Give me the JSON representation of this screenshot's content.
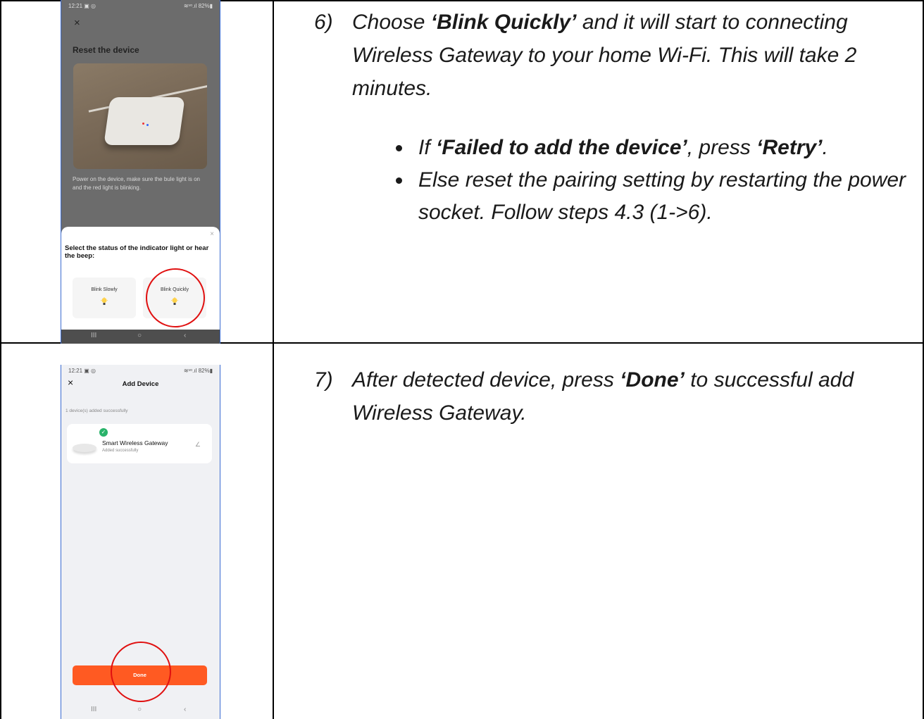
{
  "step6": {
    "number": "6)",
    "parts": [
      "Choose ",
      "‘Blink Quickly’",
      " and it will start to connecting Wireless Gateway to your home Wi-Fi. This will take 2 minutes."
    ],
    "bullet1": [
      "If ",
      "‘Failed to add the device’",
      ", press ",
      "‘Retry’",
      "."
    ],
    "bullet2": "Else reset the pairing setting by restarting the power socket. Follow steps 4.3 (1->6)."
  },
  "step7": {
    "number": "7)",
    "parts": [
      "After detected device, press ",
      "‘Done’",
      " to successful add Wireless Gateway."
    ]
  },
  "screen1": {
    "status_time": "12:21 ▣ ◎",
    "status_right": "≋ᵛᵒ.ıl 82%▮",
    "close": "×",
    "title": "Reset the device",
    "description": "Power on the device, make sure the bule light is on and the red light is blinking.",
    "sheet_close": "×",
    "question": "Select the status of the indicator light or hear the beep:",
    "option_slow": "Blink Slowly",
    "option_quick": "Blink Quickly",
    "nav": [
      "III",
      "○",
      "‹"
    ]
  },
  "screen2": {
    "status_time": "12:21 ▣ ◎",
    "status_right": "≋ᵛᵒ.ıl 82%▮",
    "close": "×",
    "header": "Add Device",
    "added_count": "1 device(s) added successfully",
    "device_name": "Smart Wireless Gateway",
    "device_status": "Added successfully",
    "check": "✓",
    "edit": "∠",
    "done": "Done",
    "nav": [
      "III",
      "○",
      "‹"
    ]
  },
  "colors": {
    "accent_orange": "#ff5a22",
    "highlight_red": "#e01010",
    "success_green": "#29b36a"
  }
}
